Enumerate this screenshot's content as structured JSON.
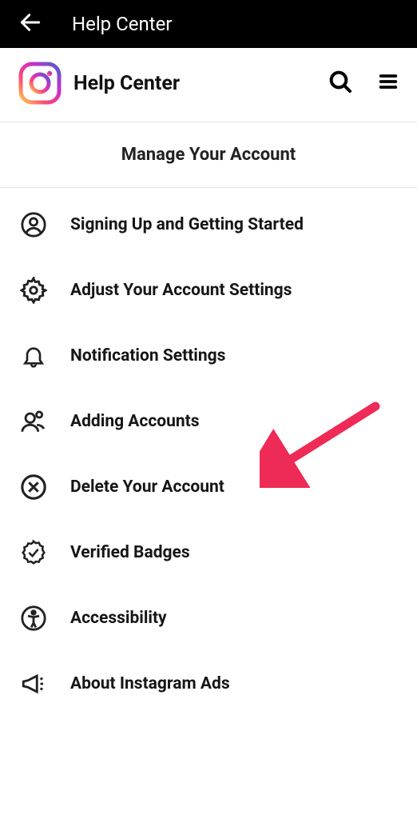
{
  "topbar": {
    "title": "Help Center"
  },
  "header": {
    "title": "Help Center"
  },
  "section": {
    "title": "Manage Your Account"
  },
  "menu": {
    "items": [
      {
        "label": "Signing Up and Getting Started"
      },
      {
        "label": "Adjust Your Account Settings"
      },
      {
        "label": "Notification Settings"
      },
      {
        "label": "Adding Accounts"
      },
      {
        "label": "Delete Your Account"
      },
      {
        "label": "Verified Badges"
      },
      {
        "label": "Accessibility"
      },
      {
        "label": "About Instagram Ads"
      }
    ]
  },
  "annotation": {
    "target_index": 4
  }
}
